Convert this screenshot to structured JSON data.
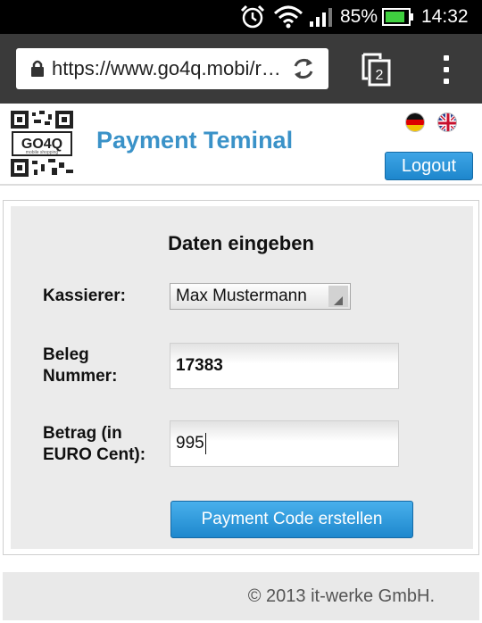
{
  "status_bar": {
    "battery_percent": "85%",
    "time": "14:32",
    "icons": [
      "alarm-icon",
      "wifi-icon",
      "signal-icon",
      "battery-icon"
    ]
  },
  "browser": {
    "url": "https://www.go4q.mobi/r…",
    "tab_count": "2",
    "icons": [
      "lock-icon",
      "reload-icon",
      "tabs-icon",
      "overflow-menu-icon"
    ]
  },
  "header": {
    "logo_text": "GO4Q",
    "logo_subtext": "mobile shopping",
    "title": "Payment Teminal",
    "logout_label": "Logout",
    "languages": [
      "de",
      "en"
    ]
  },
  "form": {
    "title": "Daten eingeben",
    "cashier_label": "Kassierer:",
    "cashier_value": "Max Mustermann",
    "receipt_label_line1": "Beleg",
    "receipt_label_line2": "Nummer:",
    "receipt_value": "17383",
    "amount_label_line1": "Betrag (in",
    "amount_label_line2": "EURO Cent):",
    "amount_value": "995",
    "submit_label": "Payment Code erstellen"
  },
  "footer": {
    "copyright": "© 2013 it-werke GmbH."
  },
  "colors": {
    "accent": "#3a92c8",
    "button": "#1e88cd"
  }
}
